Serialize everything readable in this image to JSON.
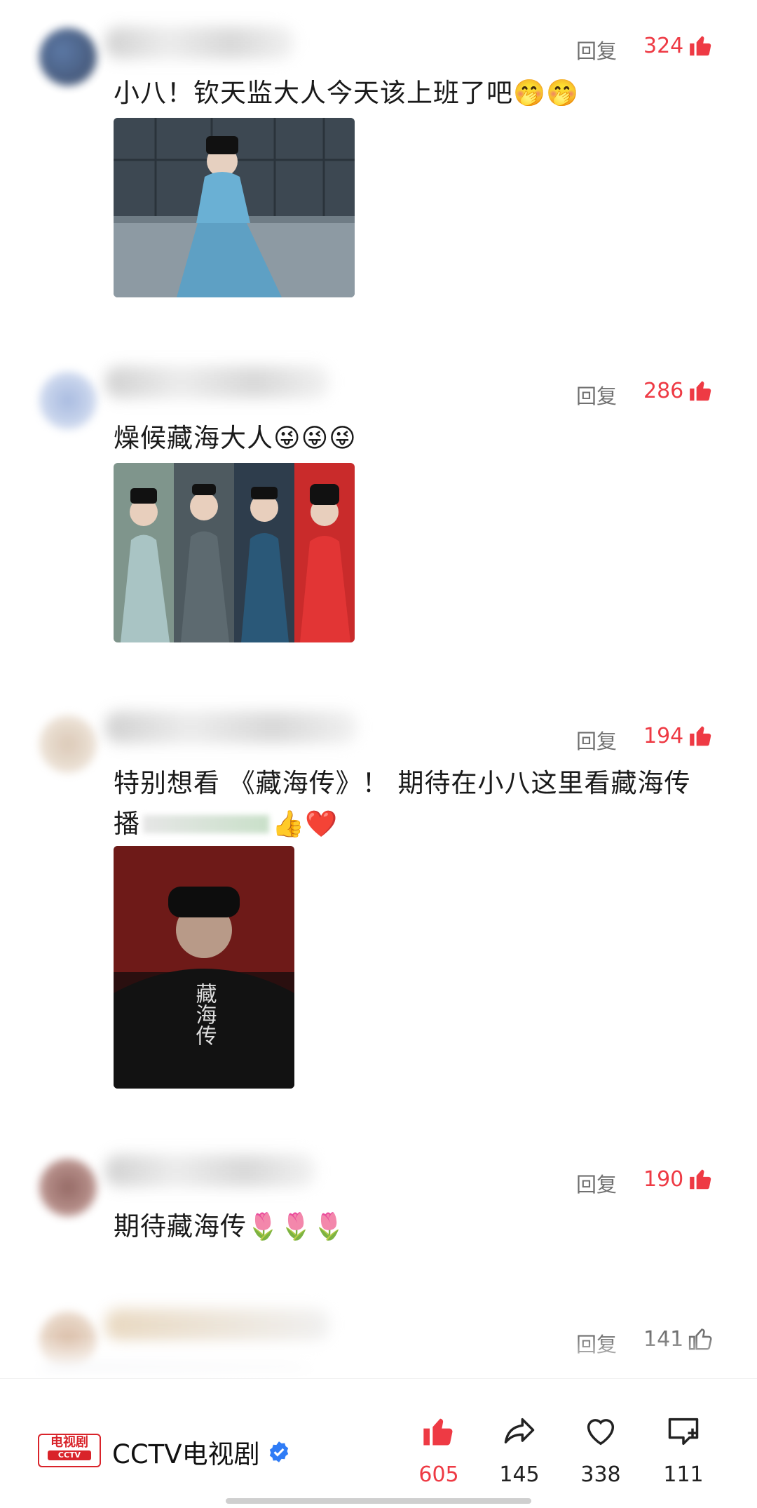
{
  "comments": [
    {
      "reply": "回复",
      "likes": "324",
      "text": "小八！钦天监大人今天该上班了吧🤭🤭"
    },
    {
      "reply": "回复",
      "likes": "286",
      "text": "燥候藏海大人😜😜😜"
    },
    {
      "reply": "回复",
      "likes": "194",
      "text": "特别想看 《藏海传》！ 期待在小八这里看藏海传",
      "text2": "播",
      "emoji": "👍❤️"
    },
    {
      "reply": "回复",
      "likes": "190",
      "text": "期待藏海传🌷🌷🌷"
    },
    {
      "reply": "回复",
      "likes": "141"
    }
  ],
  "poster_title": "藏海传",
  "bottom_bar": {
    "logo_line1": "电视剧",
    "logo_line2": "CCTV",
    "channel": "CCTV电视剧",
    "like_count": "605",
    "share_count": "145",
    "favorite_count": "338",
    "comment_count": "111"
  },
  "colors": {
    "accent": "#ee3a44",
    "verified": "#2f7cf6",
    "muted": "#707070"
  },
  "icons": [
    "thumb-up-icon",
    "share-icon",
    "heart-icon",
    "comment-add-icon",
    "verified-icon"
  ]
}
